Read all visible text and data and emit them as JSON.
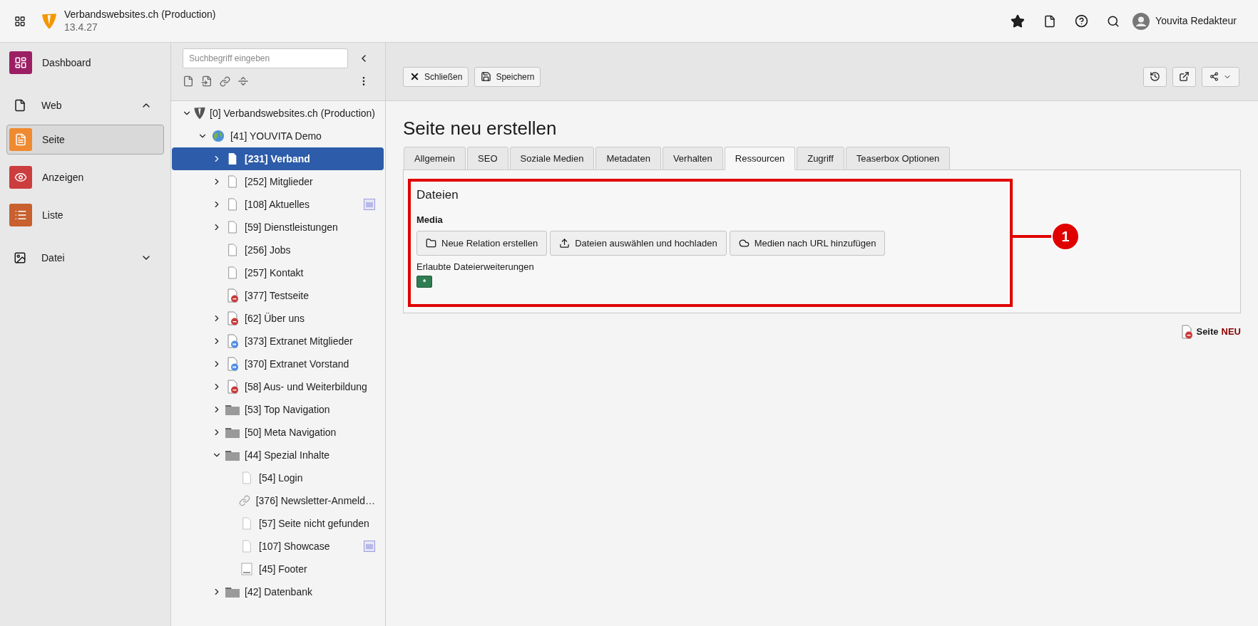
{
  "topbar": {
    "site_name": "Verbandswebsites.ch (Production)",
    "version": "13.4.27",
    "user": "Youvita Redakteur"
  },
  "modules": [
    {
      "kind": "dashboard",
      "label": "Dashboard",
      "color": "#9c1f64",
      "selected": false
    },
    {
      "kind": "web",
      "label": "Web",
      "expanded": true,
      "children": [
        {
          "kind": "page",
          "label": "Seite",
          "color": "#f08a31",
          "selected": true
        },
        {
          "kind": "view",
          "label": "Anzeigen",
          "color": "#cc3d3d",
          "selected": false
        },
        {
          "kind": "list",
          "label": "Liste",
          "color": "#c8612f",
          "selected": false
        }
      ]
    },
    {
      "kind": "file",
      "label": "Datei",
      "expanded": false
    }
  ],
  "tree": {
    "search": {
      "placeholder": "Suchbegriff eingeben"
    },
    "items": [
      {
        "label": "[0] Verbandswebsites.ch (Production)",
        "kind": "root",
        "expanded": true,
        "selected": false,
        "badge": false,
        "children": [
          {
            "label": "[41] YOUVITA Demo",
            "kind": "site",
            "expanded": true,
            "selected": false,
            "badge": false,
            "children": [
              {
                "label": "[231] Verband",
                "kind": "page",
                "expanded": false,
                "selected": true,
                "badge": false
              },
              {
                "label": "[252] Mitglieder",
                "kind": "page",
                "expanded": false,
                "selected": false,
                "badge": false
              },
              {
                "label": "[108] Aktuelles",
                "kind": "page",
                "expanded": false,
                "selected": false,
                "badge": true
              },
              {
                "label": "[59] Dienstleistungen",
                "kind": "page",
                "expanded": false,
                "selected": false,
                "badge": false
              },
              {
                "label": "[256] Jobs",
                "kind": "page",
                "selected": false,
                "badge": false
              },
              {
                "label": "[257] Kontakt",
                "kind": "page",
                "selected": false,
                "badge": false
              },
              {
                "label": "[377] Testseite",
                "kind": "hidden",
                "selected": false,
                "badge": false
              },
              {
                "label": "[62] Über uns",
                "kind": "hidden",
                "expanded": false,
                "selected": false,
                "badge": false
              },
              {
                "label": "[373] Extranet Mitglieder",
                "kind": "shortcut",
                "expanded": false,
                "selected": false,
                "badge": false
              },
              {
                "label": "[370] Extranet Vorstand",
                "kind": "shortcut",
                "expanded": false,
                "selected": false,
                "badge": false
              },
              {
                "label": "[58] Aus- und Weiterbildung",
                "kind": "hidden",
                "expanded": false,
                "selected": false,
                "badge": false
              },
              {
                "label": "[53] Top Navigation",
                "kind": "folder",
                "expanded": false,
                "selected": false,
                "badge": false
              },
              {
                "label": "[50] Meta Navigation",
                "kind": "folder",
                "expanded": false,
                "selected": false,
                "badge": false
              },
              {
                "label": "[44] Spezial Inhalte",
                "kind": "folder",
                "expanded": true,
                "selected": false,
                "badge": false,
                "children": [
                  {
                    "label": "[54] Login",
                    "kind": "light",
                    "selected": false,
                    "badge": false
                  },
                  {
                    "label": "[376] Newsletter-Anmeld…",
                    "kind": "link",
                    "selected": false,
                    "badge": false
                  },
                  {
                    "label": "[57] Seite nicht gefunden",
                    "kind": "light",
                    "selected": false,
                    "badge": false
                  },
                  {
                    "label": "[107] Showcase",
                    "kind": "light",
                    "selected": false,
                    "badge": true
                  },
                  {
                    "label": "[45] Footer",
                    "kind": "footer",
                    "selected": false,
                    "badge": false
                  }
                ]
              },
              {
                "label": "[42] Datenbank",
                "kind": "folder",
                "expanded": false,
                "selected": false,
                "badge": false
              }
            ]
          }
        ]
      }
    ]
  },
  "toolbar": {
    "buttons": [
      {
        "kind": "close",
        "label": "Schließen"
      },
      {
        "kind": "save",
        "label": "Speichern"
      }
    ]
  },
  "title": "Seite neu erstellen",
  "tabs": [
    {
      "label": "Allgemein",
      "selected": false
    },
    {
      "label": "SEO",
      "selected": false
    },
    {
      "label": "Soziale Medien",
      "selected": false
    },
    {
      "label": "Metadaten",
      "selected": false
    },
    {
      "label": "Verhalten",
      "selected": false
    },
    {
      "label": "Ressourcen",
      "selected": true
    },
    {
      "label": "Zugriff",
      "selected": false
    },
    {
      "label": "Teaserbox Optionen",
      "selected": false
    }
  ],
  "section": {
    "heading": "Dateien",
    "field_label": "Media",
    "buttons": [
      {
        "kind": "folder",
        "label": "Neue Relation erstellen"
      },
      {
        "kind": "upload",
        "label": "Dateien auswählen und hochladen"
      },
      {
        "kind": "cloud",
        "label": "Medien nach URL hinzufügen"
      }
    ],
    "extensions_label": "Erlaubte Dateierweiterungen",
    "extensions": [
      "*"
    ]
  },
  "annotation": {
    "number": "1"
  },
  "page_status": {
    "label": "Seite",
    "status": "NEU"
  }
}
